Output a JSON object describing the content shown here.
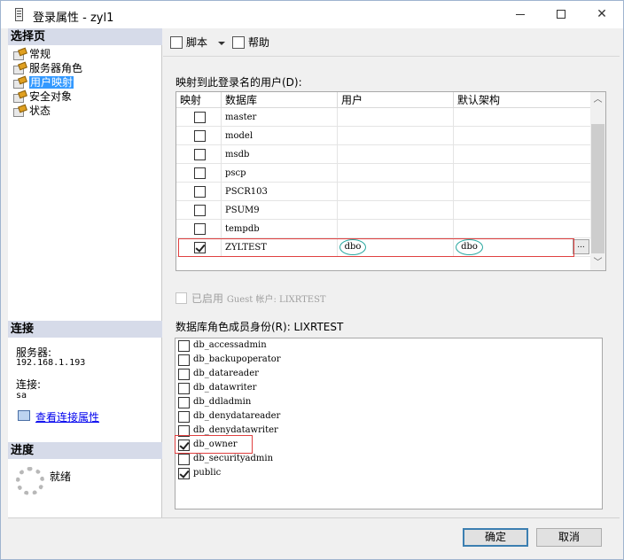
{
  "window": {
    "title": "登录属性 - zyl1",
    "controls": [
      "—",
      "☐",
      "✕"
    ]
  },
  "left": {
    "select_page_header": "选择页",
    "pages": [
      {
        "label": "常规",
        "selected": false
      },
      {
        "label": "服务器角色",
        "selected": false
      },
      {
        "label": "用户映射",
        "selected": true
      },
      {
        "label": "安全对象",
        "selected": false
      },
      {
        "label": "状态",
        "selected": false
      }
    ],
    "connection_header": "连接",
    "server_label": "服务器:",
    "server_value": "192.168.1.193",
    "connection_label": "连接:",
    "connection_value": "sa",
    "view_connection_link": "查看连接属性",
    "progress_header": "进度",
    "progress_status": "就绪"
  },
  "toolbar": {
    "script_label": "脚本",
    "help_label": "帮助"
  },
  "mapping": {
    "label": "映射到此登录名的用户(D):",
    "columns": [
      "映射",
      "数据库",
      "用户",
      "默认架构"
    ],
    "rows": [
      {
        "map": false,
        "database": "master",
        "user": "",
        "schema": ""
      },
      {
        "map": false,
        "database": "model",
        "user": "",
        "schema": ""
      },
      {
        "map": false,
        "database": "msdb",
        "user": "",
        "schema": ""
      },
      {
        "map": false,
        "database": "pscp",
        "user": "",
        "schema": ""
      },
      {
        "map": false,
        "database": "PSCR103",
        "user": "",
        "schema": ""
      },
      {
        "map": false,
        "database": "PSUM9",
        "user": "",
        "schema": ""
      },
      {
        "map": false,
        "database": "tempdb",
        "user": "",
        "schema": ""
      },
      {
        "map": true,
        "database": "ZYLTEST",
        "user": "dbo",
        "schema": "dbo"
      }
    ],
    "ellipsis": "..."
  },
  "guest": {
    "label_prefix": "已启用 ",
    "label_mono": "Guest 帐户: LIXRTEST"
  },
  "roles": {
    "label": "数据库角色成员身份(R): LIXRTEST",
    "items": [
      {
        "name": "db_accessadmin",
        "checked": false
      },
      {
        "name": "db_backupoperator",
        "checked": false
      },
      {
        "name": "db_datareader",
        "checked": false
      },
      {
        "name": "db_datawriter",
        "checked": false
      },
      {
        "name": "db_ddladmin",
        "checked": false
      },
      {
        "name": "db_denydatareader",
        "checked": false
      },
      {
        "name": "db_denydatawriter",
        "checked": false
      },
      {
        "name": "db_owner",
        "checked": true
      },
      {
        "name": "db_securityadmin",
        "checked": false
      },
      {
        "name": "public",
        "checked": true
      }
    ]
  },
  "buttons": {
    "ok": "确定",
    "cancel": "取消"
  },
  "colors": {
    "highlight": "#3399ff",
    "annotation_red": "#e04040",
    "annotation_teal": "#2aa8a0"
  }
}
